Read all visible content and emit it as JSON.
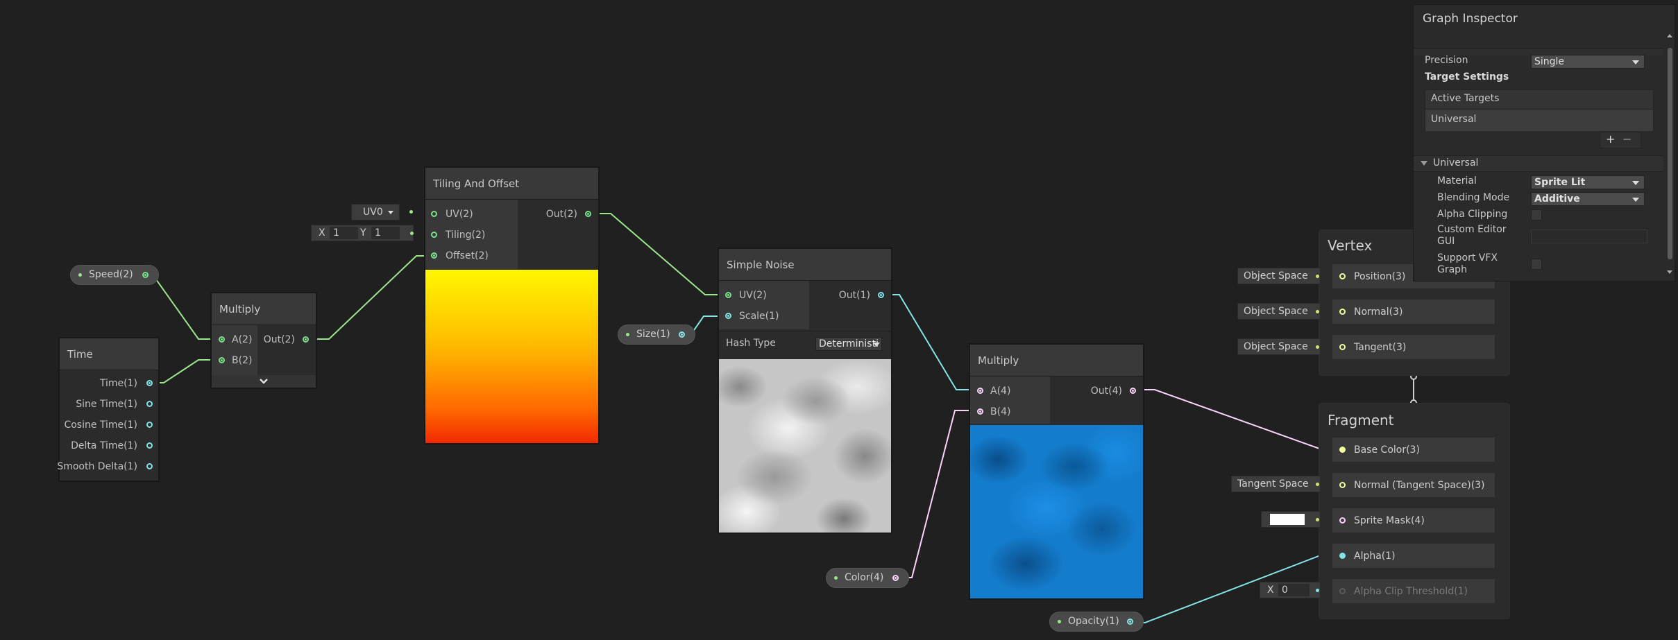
{
  "time_node": {
    "title": "Time",
    "outputs": [
      "Time(1)",
      "Sine Time(1)",
      "Cosine Time(1)",
      "Delta Time(1)",
      "Smooth Delta(1)"
    ]
  },
  "speed_property": "Speed(2)",
  "multiply1": {
    "title": "Multiply",
    "in_a": "A(2)",
    "in_b": "B(2)",
    "out": "Out(2)",
    "expand_icon": "chevron-down-icon"
  },
  "tiling": {
    "title": "Tiling And Offset",
    "in_uv": "UV(2)",
    "in_tiling": "Tiling(2)",
    "in_offset": "Offset(2)",
    "out": "Out(2)",
    "uv_dropdown": "UV0",
    "tiling_x_label": "X",
    "tiling_x_value": "1",
    "tiling_y_label": "Y",
    "tiling_y_value": "1"
  },
  "noise": {
    "title": "Simple Noise",
    "in_uv": "UV(2)",
    "in_scale": "Scale(1)",
    "out": "Out(1)",
    "hash_label": "Hash Type",
    "hash_value": "Deterministi"
  },
  "size_property": "Size(1)",
  "multiply2": {
    "title": "Multiply",
    "in_a": "A(4)",
    "in_b": "B(4)",
    "out": "Out(4)"
  },
  "color_property": "Color(4)",
  "opacity_property": "Opacity(1)",
  "vertex": {
    "title": "Vertex",
    "slots": [
      {
        "label": "Position(3)",
        "tag": "Object Space"
      },
      {
        "label": "Normal(3)",
        "tag": "Object Space"
      },
      {
        "label": "Tangent(3)",
        "tag": "Object Space"
      }
    ]
  },
  "fragment": {
    "title": "Fragment",
    "base_color": "Base Color(3)",
    "normal": "Normal (Tangent Space)(3)",
    "normal_tag": "Tangent Space",
    "sprite_mask": "Sprite Mask(4)",
    "alpha": "Alpha(1)",
    "alpha_clip": "Alpha Clip Threshold(1)",
    "alpha_clip_x_label": "X",
    "alpha_clip_x_value": "0"
  },
  "inspector": {
    "title": "Graph Inspector",
    "precision_label": "Precision",
    "precision_value": "Single",
    "target_settings": "Target Settings",
    "active_targets": "Active Targets",
    "universal_item": "Universal",
    "add_button": "+",
    "remove_button": "−",
    "section_universal": "Universal",
    "material_label": "Material",
    "material_value": "Sprite Lit",
    "blending_label": "Blending Mode",
    "blending_value": "Additive",
    "alpha_clipping_label": "Alpha Clipping",
    "custom_editor_label_1": "Custom Editor",
    "custom_editor_label_2": "GUI",
    "support_vfx_label_1": "Support VFX",
    "support_vfx_label_2": "Graph"
  },
  "colors": {
    "wire_vec2": "#9be88c",
    "wire_vec1": "#84e4e7",
    "wire_vec4": "#fcd3fd",
    "wire_vec3": "#f6ff9a",
    "canvas": "#202020"
  }
}
